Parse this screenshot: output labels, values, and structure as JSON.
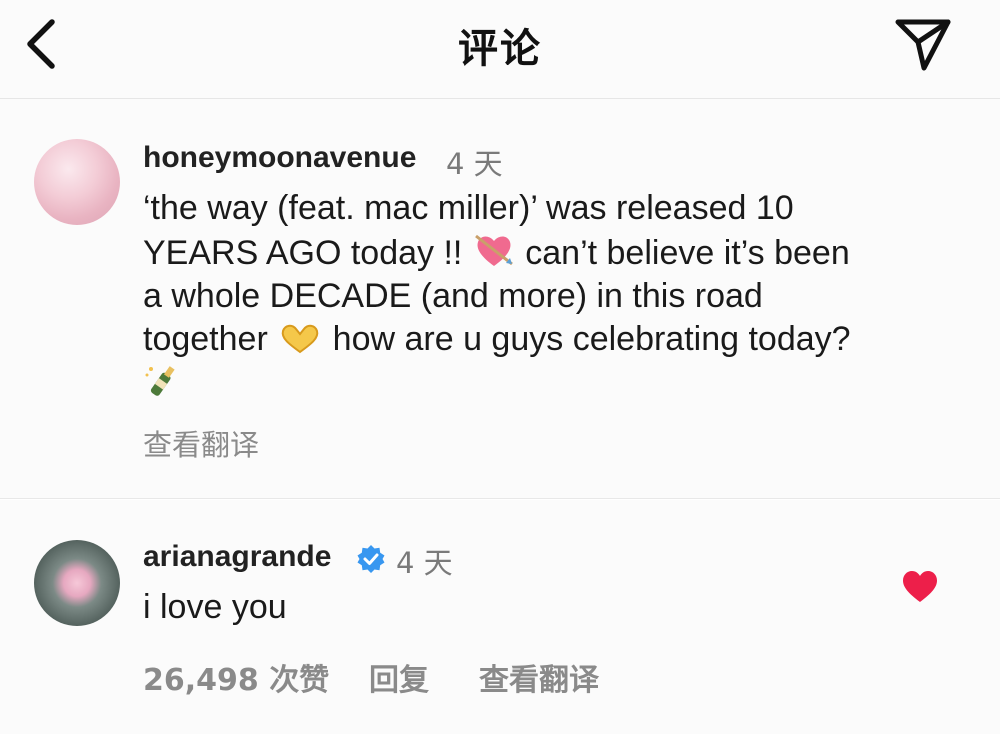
{
  "header": {
    "title": "评论",
    "back_icon": "chevron-left-icon",
    "share_icon": "paper-plane-icon"
  },
  "post": {
    "username": "honeymoonavenue",
    "time": "4 天",
    "text_line1": "‘the way (feat. mac miller)’ was released 10",
    "text_line2a": "YEARS AGO today !! ",
    "text_line2b": " can’t believe it’s been",
    "text_line3": "a whole DECADE (and more) in this road",
    "text_line4a": "together ",
    "text_line4b": " how are u guys celebrating today?",
    "emoji_1": "heart-with-arrow-icon",
    "emoji_2": "heart-hands-icon",
    "emoji_3": "champagne-icon",
    "translate_label": "查看翻译"
  },
  "reply": {
    "username": "arianagrande",
    "verified_icon": "verified-badge-icon",
    "time": "4 天",
    "text": "i love you",
    "likes": "26,498 次赞",
    "reply_label": "回复",
    "translate_label": "查看翻译",
    "liked_color": "#ed1f4a"
  },
  "colors": {
    "accent_blue": "#3897f0",
    "heart_red": "#ed1f4a",
    "secondary_text": "#8a8a8a"
  }
}
